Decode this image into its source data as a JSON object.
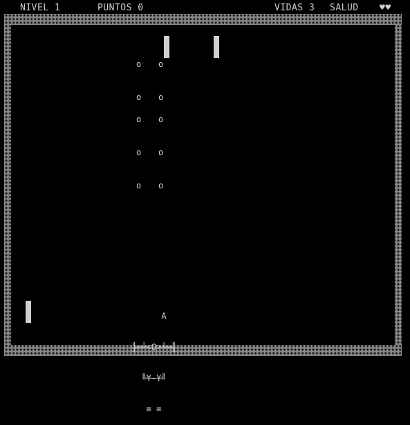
{
  "hud": {
    "level": "NIVEL 1",
    "score": "PUNTOS 0",
    "lives": "VIDAS 3",
    "health_label": "SALUD",
    "health_hearts": "♥♥"
  },
  "ship": {
    "lines": [
      "      A",
      "╠═╧<O>╧═╣",
      "  ╚¥—¥╝",
      "   ≡ ≡"
    ]
  },
  "bullets": [
    "o",
    "o",
    "o",
    "o",
    "o",
    "o",
    "o",
    "o",
    "o",
    "o"
  ]
}
